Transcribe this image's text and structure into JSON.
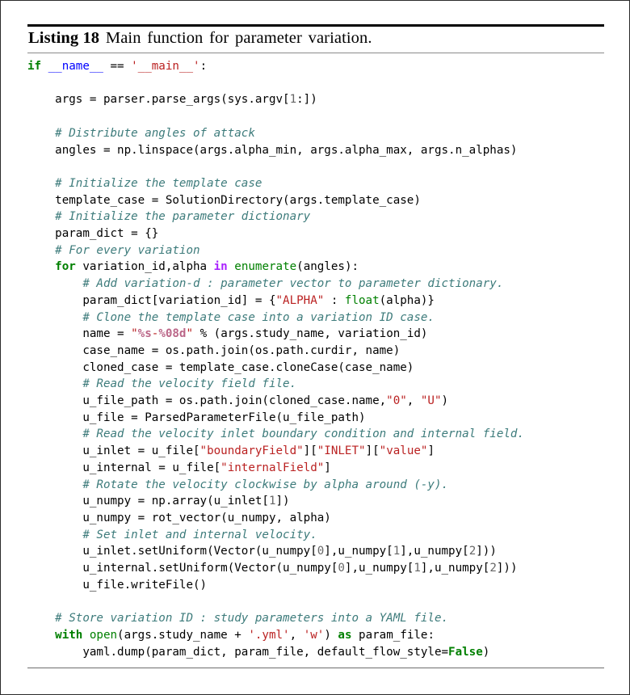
{
  "caption": {
    "label": "Listing 18",
    "text": "Main function for parameter variation."
  },
  "code": {
    "language": "python",
    "lines": [
      {
        "indent": 0,
        "tokens": [
          {
            "t": "if ",
            "c": "k"
          },
          {
            "t": "__name__",
            "c": "nf"
          },
          {
            "t": " == ",
            "c": ""
          },
          {
            "t": "'__main__'",
            "c": "s"
          },
          {
            "t": ":",
            "c": ""
          }
        ]
      },
      {
        "indent": 0,
        "tokens": []
      },
      {
        "indent": 4,
        "tokens": [
          {
            "t": "args = parser.parse_args(sys.argv[",
            "c": ""
          },
          {
            "t": "1",
            "c": "m"
          },
          {
            "t": ":])",
            "c": ""
          }
        ]
      },
      {
        "indent": 0,
        "tokens": []
      },
      {
        "indent": 4,
        "tokens": [
          {
            "t": "# Distribute angles of attack",
            "c": "c"
          }
        ]
      },
      {
        "indent": 4,
        "tokens": [
          {
            "t": "angles = np.linspace(args.alpha_min, args.alpha_max, args.n_alphas)",
            "c": ""
          }
        ]
      },
      {
        "indent": 0,
        "tokens": []
      },
      {
        "indent": 4,
        "tokens": [
          {
            "t": "# Initialize the template case",
            "c": "c"
          }
        ]
      },
      {
        "indent": 4,
        "tokens": [
          {
            "t": "template_case = SolutionDirectory(args.template_case)",
            "c": ""
          }
        ]
      },
      {
        "indent": 4,
        "tokens": [
          {
            "t": "# Initialize the parameter dictionary",
            "c": "c"
          }
        ]
      },
      {
        "indent": 4,
        "tokens": [
          {
            "t": "param_dict = {}",
            "c": ""
          }
        ]
      },
      {
        "indent": 4,
        "tokens": [
          {
            "t": "# For every variation",
            "c": "c"
          }
        ]
      },
      {
        "indent": 4,
        "tokens": [
          {
            "t": "for ",
            "c": "k"
          },
          {
            "t": "variation_id,alpha ",
            "c": ""
          },
          {
            "t": "in",
            "c": "kw"
          },
          {
            "t": " ",
            "c": ""
          },
          {
            "t": "enumerate",
            "c": "nb"
          },
          {
            "t": "(angles):",
            "c": ""
          }
        ]
      },
      {
        "indent": 8,
        "tokens": [
          {
            "t": "# Add variation-d : parameter vector to parameter dictionary.",
            "c": "c"
          }
        ]
      },
      {
        "indent": 8,
        "tokens": [
          {
            "t": "param_dict[variation_id] = {",
            "c": ""
          },
          {
            "t": "\"ALPHA\"",
            "c": "s"
          },
          {
            "t": " : ",
            "c": ""
          },
          {
            "t": "float",
            "c": "nb"
          },
          {
            "t": "(alpha)}",
            "c": ""
          }
        ]
      },
      {
        "indent": 8,
        "tokens": [
          {
            "t": "# Clone the template case into a variation ID case.",
            "c": "c"
          }
        ]
      },
      {
        "indent": 8,
        "tokens": [
          {
            "t": "name = ",
            "c": ""
          },
          {
            "t": "\"",
            "c": "s"
          },
          {
            "t": "%s",
            "c": "si"
          },
          {
            "t": "-",
            "c": "s"
          },
          {
            "t": "%08d",
            "c": "si"
          },
          {
            "t": "\"",
            "c": "s"
          },
          {
            "t": " % (args.study_name, variation_id)",
            "c": ""
          }
        ]
      },
      {
        "indent": 8,
        "tokens": [
          {
            "t": "case_name = os.path.join(os.path.curdir, name)",
            "c": ""
          }
        ]
      },
      {
        "indent": 8,
        "tokens": [
          {
            "t": "cloned_case = template_case.cloneCase(case_name)",
            "c": ""
          }
        ]
      },
      {
        "indent": 8,
        "tokens": [
          {
            "t": "# Read the velocity field file.",
            "c": "c"
          }
        ]
      },
      {
        "indent": 8,
        "tokens": [
          {
            "t": "u_file_path = os.path.join(cloned_case.name,",
            "c": ""
          },
          {
            "t": "\"0\"",
            "c": "s"
          },
          {
            "t": ", ",
            "c": ""
          },
          {
            "t": "\"U\"",
            "c": "s"
          },
          {
            "t": ")",
            "c": ""
          }
        ]
      },
      {
        "indent": 8,
        "tokens": [
          {
            "t": "u_file = ParsedParameterFile(u_file_path)",
            "c": ""
          }
        ]
      },
      {
        "indent": 8,
        "tokens": [
          {
            "t": "# Read the velocity inlet boundary condition and internal field.",
            "c": "c"
          }
        ]
      },
      {
        "indent": 8,
        "tokens": [
          {
            "t": "u_inlet = u_file[",
            "c": ""
          },
          {
            "t": "\"boundaryField\"",
            "c": "s"
          },
          {
            "t": "][",
            "c": ""
          },
          {
            "t": "\"INLET\"",
            "c": "s"
          },
          {
            "t": "][",
            "c": ""
          },
          {
            "t": "\"value\"",
            "c": "s"
          },
          {
            "t": "]",
            "c": ""
          }
        ]
      },
      {
        "indent": 8,
        "tokens": [
          {
            "t": "u_internal = u_file[",
            "c": ""
          },
          {
            "t": "\"internalField\"",
            "c": "s"
          },
          {
            "t": "]",
            "c": ""
          }
        ]
      },
      {
        "indent": 8,
        "tokens": [
          {
            "t": "# Rotate the velocity clockwise by alpha around (-y).",
            "c": "c"
          }
        ]
      },
      {
        "indent": 8,
        "tokens": [
          {
            "t": "u_numpy = np.array(u_inlet[",
            "c": ""
          },
          {
            "t": "1",
            "c": "m"
          },
          {
            "t": "])",
            "c": ""
          }
        ]
      },
      {
        "indent": 8,
        "tokens": [
          {
            "t": "u_numpy = rot_vector(u_numpy, alpha)",
            "c": ""
          }
        ]
      },
      {
        "indent": 8,
        "tokens": [
          {
            "t": "# Set inlet and internal velocity.",
            "c": "c"
          }
        ]
      },
      {
        "indent": 8,
        "tokens": [
          {
            "t": "u_inlet.setUniform(Vector(u_numpy[",
            "c": ""
          },
          {
            "t": "0",
            "c": "m"
          },
          {
            "t": "],u_numpy[",
            "c": ""
          },
          {
            "t": "1",
            "c": "m"
          },
          {
            "t": "],u_numpy[",
            "c": ""
          },
          {
            "t": "2",
            "c": "m"
          },
          {
            "t": "]))",
            "c": ""
          }
        ]
      },
      {
        "indent": 8,
        "tokens": [
          {
            "t": "u_internal.setUniform(Vector(u_numpy[",
            "c": ""
          },
          {
            "t": "0",
            "c": "m"
          },
          {
            "t": "],u_numpy[",
            "c": ""
          },
          {
            "t": "1",
            "c": "m"
          },
          {
            "t": "],u_numpy[",
            "c": ""
          },
          {
            "t": "2",
            "c": "m"
          },
          {
            "t": "]))",
            "c": ""
          }
        ]
      },
      {
        "indent": 8,
        "tokens": [
          {
            "t": "u_file.writeFile()",
            "c": ""
          }
        ]
      },
      {
        "indent": 0,
        "tokens": []
      },
      {
        "indent": 4,
        "tokens": [
          {
            "t": "# Store variation ID : study parameters into a YAML file.",
            "c": "c"
          }
        ]
      },
      {
        "indent": 4,
        "tokens": [
          {
            "t": "with ",
            "c": "k"
          },
          {
            "t": "open",
            "c": "nb"
          },
          {
            "t": "(args.study_name + ",
            "c": ""
          },
          {
            "t": "'.yml'",
            "c": "s"
          },
          {
            "t": ", ",
            "c": ""
          },
          {
            "t": "'w'",
            "c": "s"
          },
          {
            "t": ") ",
            "c": ""
          },
          {
            "t": "as",
            "c": "k"
          },
          {
            "t": " param_file:",
            "c": ""
          }
        ]
      },
      {
        "indent": 8,
        "tokens": [
          {
            "t": "yaml.dump(param_dict, param_file, default_flow_style=",
            "c": ""
          },
          {
            "t": "False",
            "c": "kc"
          },
          {
            "t": ")",
            "c": ""
          }
        ]
      }
    ]
  }
}
